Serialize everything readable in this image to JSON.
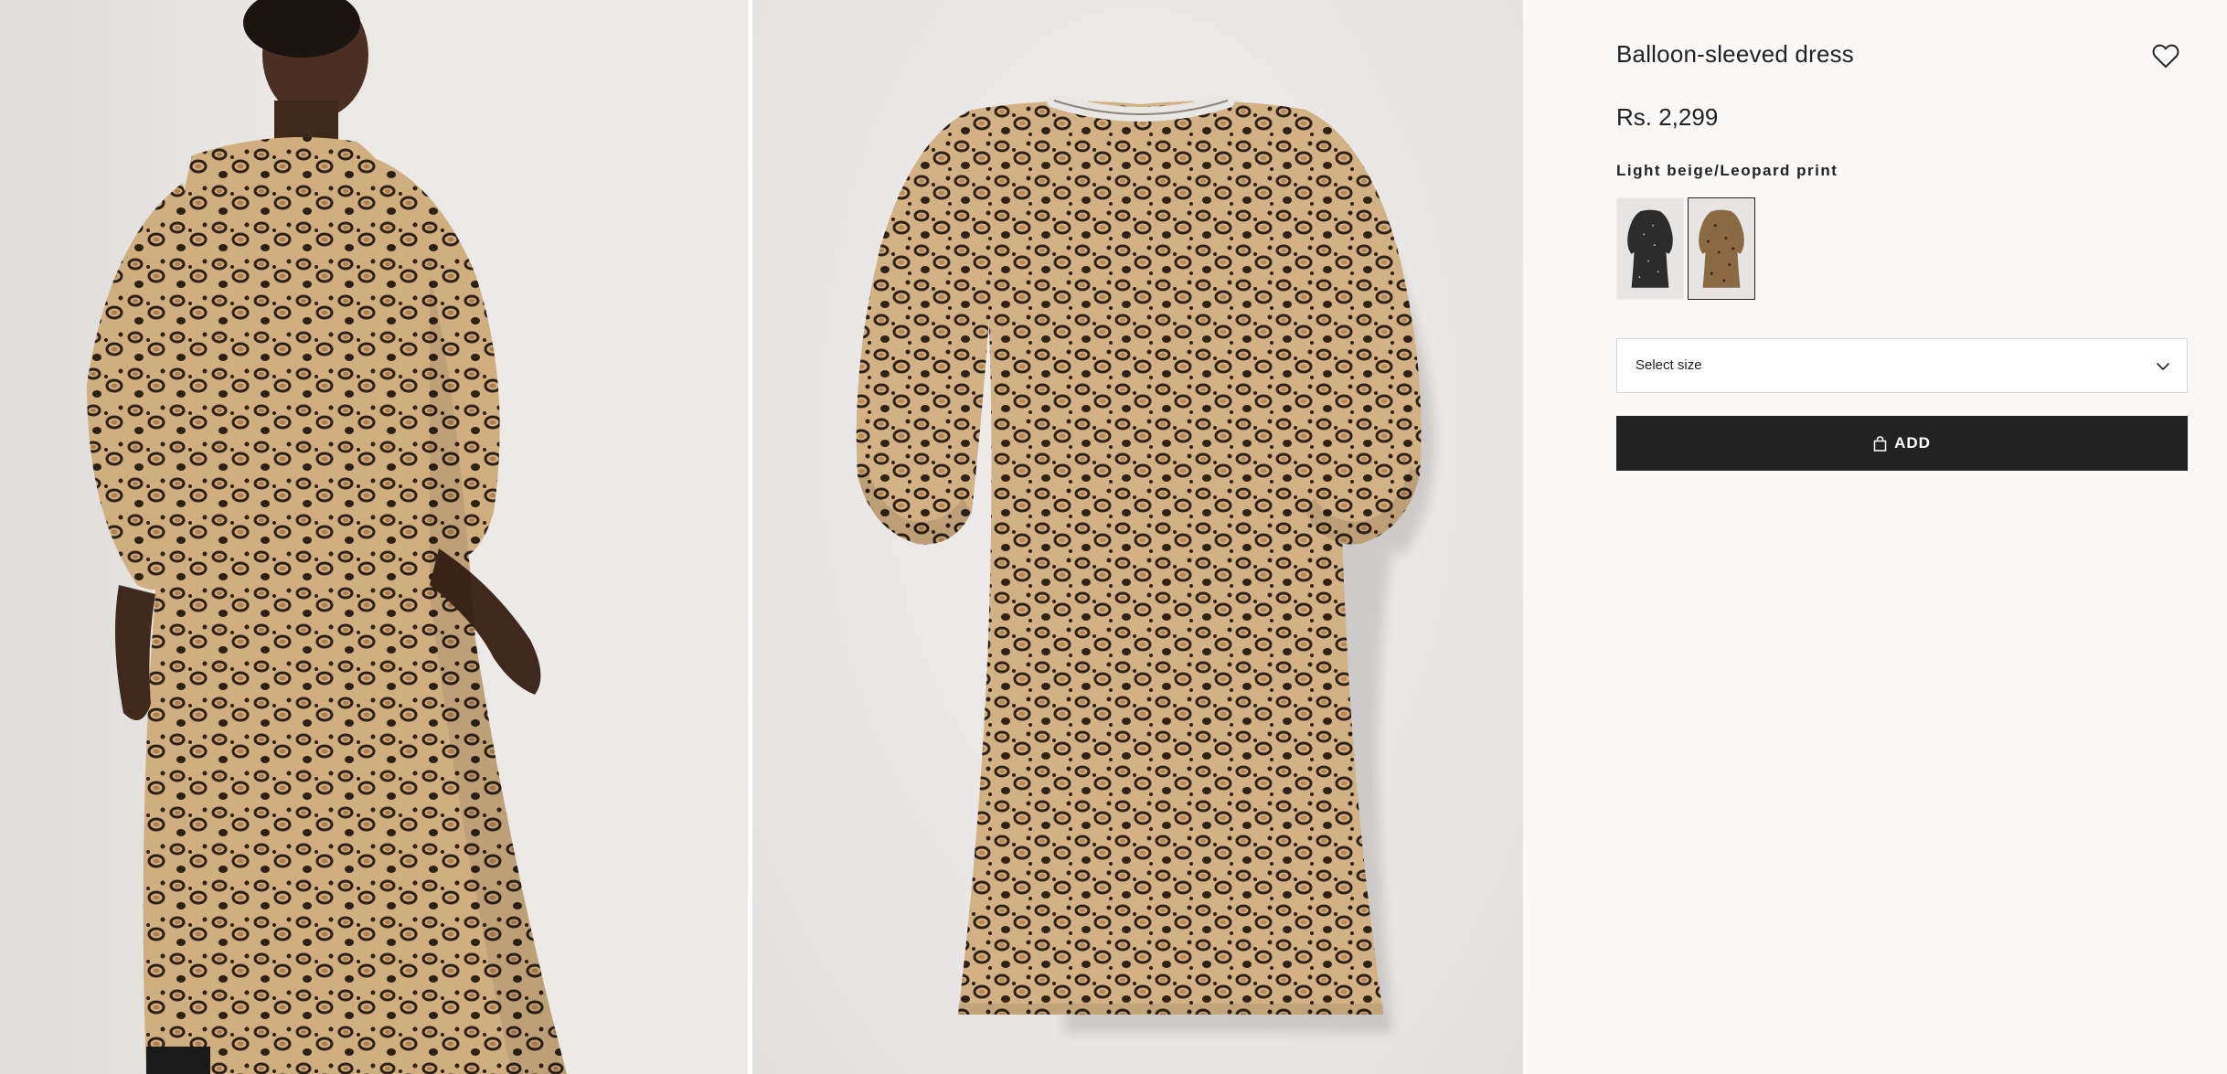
{
  "product": {
    "title": "Balloon-sleeved dress",
    "price": "Rs. 2,299",
    "color_name": "Light beige/Leopard print",
    "favorite_icon": "heart-icon"
  },
  "swatches": [
    {
      "name": "Black dotted dress",
      "selected": false,
      "color": "#2c2c2c"
    },
    {
      "name": "Light beige/Leopard print",
      "selected": true,
      "color": "#8a6a43"
    }
  ],
  "size_select": {
    "label": "Select size",
    "icon": "chevron-down-icon"
  },
  "add_button": {
    "label": "ADD",
    "icon": "bag-icon"
  },
  "colors": {
    "panel_background": "#faf9f8",
    "text": "#222222",
    "button_background": "#222222",
    "button_text": "#ffffff",
    "leopard_base": "#c9a87a",
    "leopard_spot": "#3b2a1c"
  }
}
